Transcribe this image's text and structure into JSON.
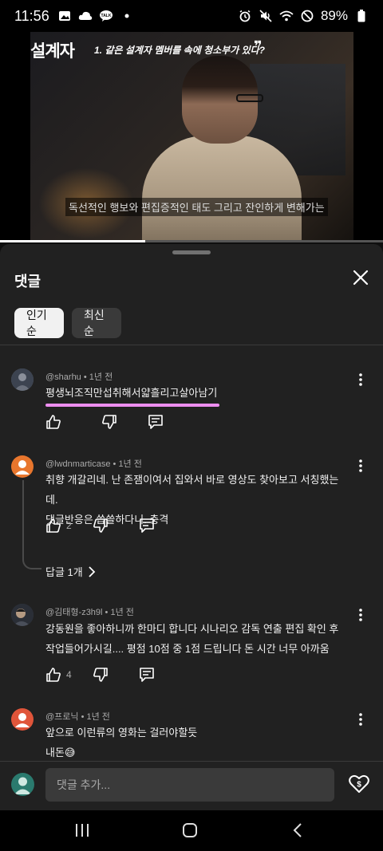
{
  "status_bar": {
    "time": "11:56",
    "battery": "89%",
    "left_icons": [
      "image-icon",
      "cloud-icon",
      "talk-icon",
      "dot-icon"
    ],
    "right_icons": [
      "alarm-icon",
      "mute-icon",
      "wifi-icon",
      "dnd-icon",
      "battery-icon"
    ]
  },
  "video": {
    "title": "설계자",
    "subtitle": "1. 같은 설계자 멤버를 속에 청소부가 있다?",
    "quote_mark": "❞",
    "caption": "독선적인 행보와 편집증적인 태도 그리고 잔인하게 변해가는",
    "progress": 0.38
  },
  "sheet": {
    "title": "댓글",
    "filters": [
      {
        "label": "인기순",
        "active": true
      },
      {
        "label": "최신순",
        "active": false
      }
    ]
  },
  "comments": [
    {
      "author": "@sharhu",
      "age": "1년 전",
      "text": "평생뇌조직만섭취해서얇흘리고살아남기",
      "likes": "",
      "replies": "",
      "avatar_color": "#5a6270"
    },
    {
      "author": "@lwdnmarticase",
      "age": "1년 전",
      "text_lines": [
        "취향 개갈리네. 난 존잼이여서 집와서 바로 영상도 찾아보고 서칭했는데.",
        "댓글반응은 씁쓸하다니. 충격"
      ],
      "likes": "2",
      "replies": "답글 1개",
      "avatar_color": "#e8762d"
    },
    {
      "author": "@김태형-z3h9l",
      "age": "1년 전",
      "text_lines": [
        "강동원을 좋아하니까 한마디 합니다 시나리오 감독 연출 편집 확인 후",
        "작업들어가시길.... 평점 10점 중 1점 드립니다 돈 시간 너무 아까움"
      ],
      "likes": "4",
      "replies": "",
      "avatar_color": "#3a3f4a"
    },
    {
      "author": "@프로닉",
      "age": "1년 전",
      "text_lines": [
        "앞으로 이런류의 영화는 걸러야할듯",
        "내돈😅"
      ],
      "likes": "",
      "replies": "",
      "avatar_color": "#e0553a"
    }
  ],
  "input": {
    "placeholder": "댓글 추가..."
  },
  "colors": {
    "background": "#0f0f0f",
    "sheet": "#212121",
    "chip_active": "#f1f1f1",
    "chip_inactive": "#3a3a3a",
    "highlight": "#ee8ef0",
    "secondary_text": "#aaaaaa"
  },
  "nav": {
    "buttons": [
      "recents-icon",
      "home-icon",
      "back-icon"
    ]
  }
}
